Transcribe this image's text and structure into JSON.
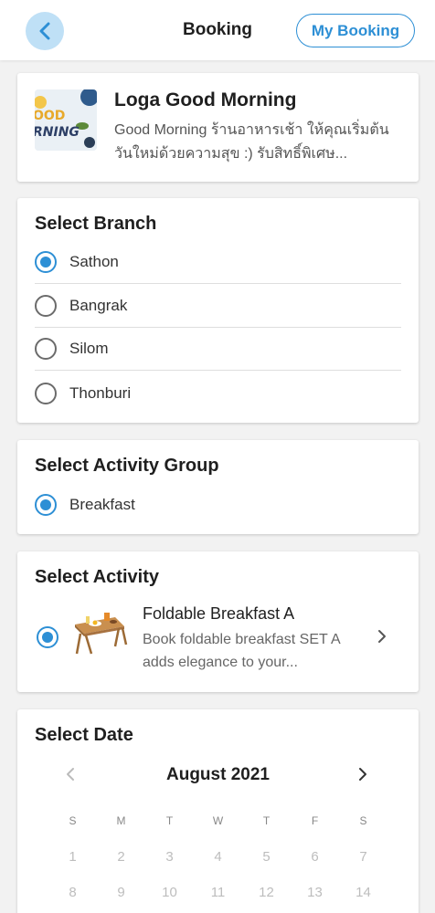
{
  "header": {
    "title": "Booking",
    "my_booking_label": "My Booking",
    "back_icon": "chevron-left-icon"
  },
  "shop": {
    "name": "Loga Good Morning",
    "description": "Good Morning ร้านอาหารเช้า ให้คุณเริ่มต้นวันใหม่ด้วยความสุข :) รับสิทธิ์พิเศษ...",
    "thumb_text": "OOD MORNING"
  },
  "branch": {
    "title": "Select Branch",
    "options": [
      {
        "label": "Sathon",
        "selected": true
      },
      {
        "label": "Bangrak",
        "selected": false
      },
      {
        "label": "Silom",
        "selected": false
      },
      {
        "label": "Thonburi",
        "selected": false
      }
    ]
  },
  "activity_group": {
    "title": "Select Activity Group",
    "options": [
      {
        "label": "Breakfast",
        "selected": true
      }
    ]
  },
  "activity": {
    "title": "Select Activity",
    "item": {
      "name": "Foldable Breakfast A",
      "description": "Book foldable breakfast SET A adds elegance to your...",
      "selected": true
    }
  },
  "date": {
    "title": "Select Date",
    "month": "August 2021",
    "weekdays": [
      "S",
      "M",
      "T",
      "W",
      "T",
      "F",
      "S"
    ],
    "weeks": [
      [
        "1",
        "2",
        "3",
        "4",
        "5",
        "6",
        "7"
      ],
      [
        "8",
        "9",
        "10",
        "11",
        "12",
        "13",
        "14"
      ]
    ]
  },
  "colors": {
    "accent": "#2d8fd5",
    "back_button_bg": "#bfe0f6",
    "page_bg": "#f2f2f2"
  }
}
